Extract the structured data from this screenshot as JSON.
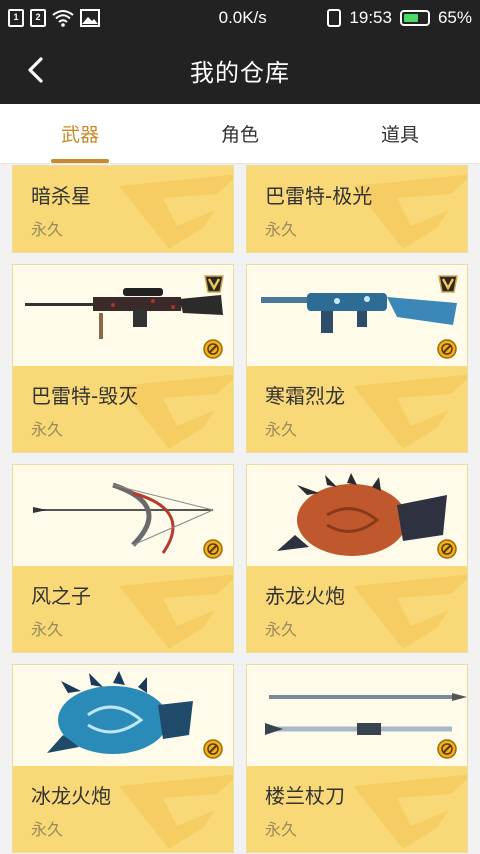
{
  "statusbar": {
    "sim1": "1",
    "sim2": "2",
    "speed": "0.0K/s",
    "time": "19:53",
    "battery": "65%",
    "battery_level": 0.65,
    "icons": [
      "sim1-icon",
      "sim2-icon",
      "wifi-icon",
      "image-icon",
      "vibrate-icon",
      "battery-icon"
    ]
  },
  "header": {
    "title": "我的仓库"
  },
  "tabs": [
    {
      "label": "武器",
      "active": true
    },
    {
      "label": "角色",
      "active": false
    },
    {
      "label": "道具",
      "active": false
    }
  ],
  "colors": {
    "accent": "#c88a2a",
    "card_info": "#f9d977",
    "card_image": "#fffbea",
    "header": "#222222"
  },
  "items": [
    {
      "name": "暗杀星",
      "duration": "永久"
    },
    {
      "name": "巴雷特-极光",
      "duration": "永久"
    },
    {
      "name": "巴雷特-毁灭",
      "duration": "永久"
    },
    {
      "name": "寒霜烈龙",
      "duration": "永久"
    },
    {
      "name": "风之子",
      "duration": "永久"
    },
    {
      "name": "赤龙火炮",
      "duration": "永久"
    },
    {
      "name": "冰龙火炮",
      "duration": "永久"
    },
    {
      "name": "楼兰杖刀",
      "duration": "永久"
    }
  ]
}
